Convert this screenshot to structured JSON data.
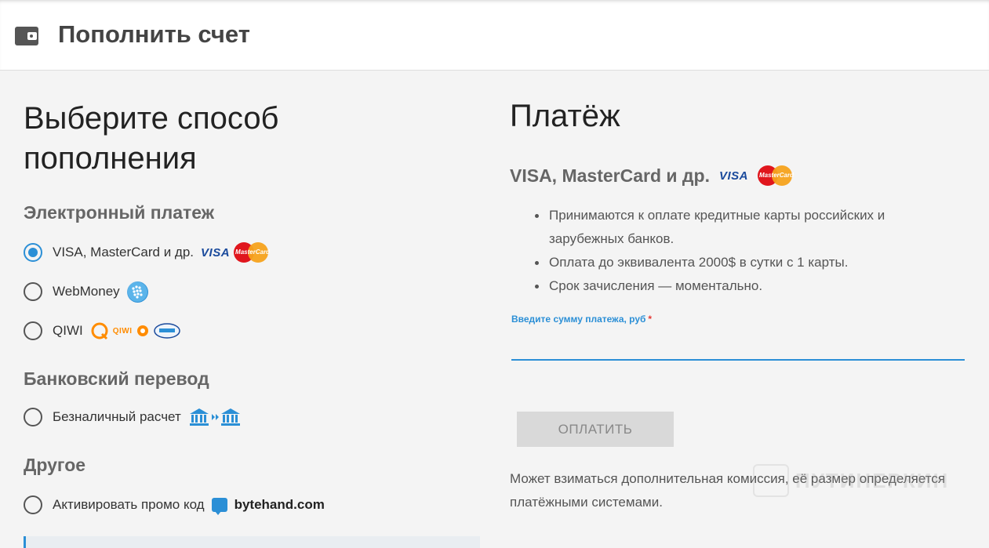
{
  "header": {
    "title": "Пополнить счет"
  },
  "left": {
    "heading_line1": "Выберите способ",
    "heading_line2": "пополнения",
    "sections": {
      "electronic": "Электронный платеж",
      "bank": "Банковский перевод",
      "other": "Другое"
    },
    "options": {
      "visa": {
        "label": "VISA, MasterCard и др.",
        "selected": true
      },
      "webmoney": {
        "label": "WebMoney",
        "selected": false
      },
      "qiwi": {
        "label": "QIWI",
        "selected": false
      },
      "cashless": {
        "label": "Безналичный расчет",
        "selected": false
      },
      "promo": {
        "label": "Активировать промо код",
        "selected": false
      }
    },
    "logos": {
      "visa_text": "VISA",
      "mastercard_text": "MasterCard",
      "qiwi_text": "QIWI",
      "bytehand": "bytehand.com"
    }
  },
  "right": {
    "heading": "Платёж",
    "method_title": "VISA, MasterCard и др.",
    "bullets": [
      "Принимаются к оплате кредитные карты российских и зарубежных банков.",
      "Оплата до эквивалента 2000$ в сутки с 1 карты.",
      "Срок зачисления — моментально."
    ],
    "amount_label": "Введите сумму платежа, руб",
    "required_mark": "*",
    "amount_value": "",
    "pay_button": "ОПЛАТИТЬ",
    "note": "Может взиматься дополнительная комиссия, её размер определяется платёжными системами."
  },
  "watermark": "ПУТИНЕРКИН",
  "colors": {
    "accent": "#2b8fd6",
    "required": "#e53935",
    "button_bg": "#d9d9d9"
  }
}
